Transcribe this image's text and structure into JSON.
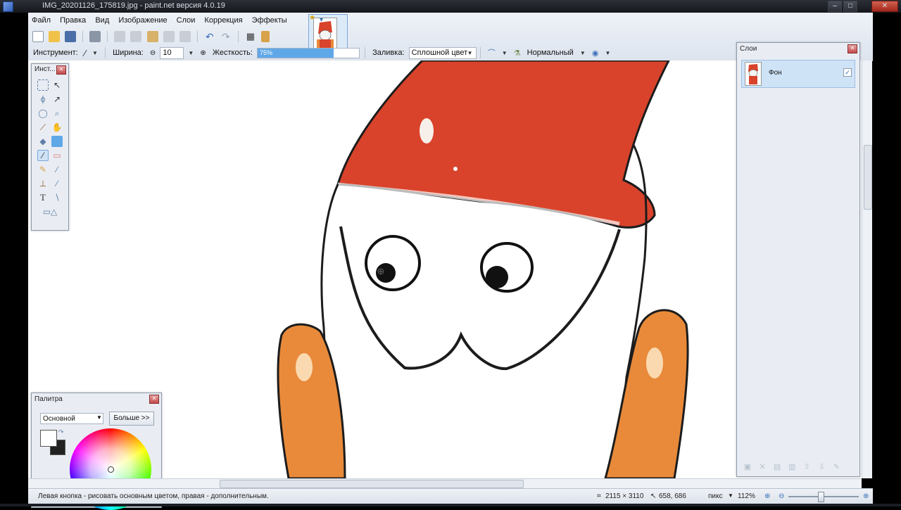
{
  "window": {
    "title": "IMG_20201126_175819.jpg - paint.net версия 4.0.19"
  },
  "menu": [
    "Файл",
    "Правка",
    "Вид",
    "Изображение",
    "Слои",
    "Коррекция",
    "Эффекты"
  ],
  "toolbar_options": {
    "tool_label": "Инструмент:",
    "width_label": "Ширина:",
    "width_value": "10",
    "hardness_label": "Жесткость:",
    "hardness_value": "75%",
    "hardness_percent": 75,
    "fill_label": "Заливка:",
    "fill_value": "Сплошной цвет",
    "blend_value": "Нормальный"
  },
  "tools_panel": {
    "title": "Инст..."
  },
  "palette_panel": {
    "title": "Палитра",
    "mode": "Основной",
    "more_button": "Больше >>",
    "colors": {
      "primary": "#ffffff",
      "secondary": "#222222"
    }
  },
  "layers_panel": {
    "title": "Слои",
    "layers": [
      {
        "name": "Фон",
        "visible": true
      }
    ]
  },
  "status": {
    "hint": "Левая кнопка - рисовать основным цветом, правая - дополнительным.",
    "image_size": "2115 × 3110",
    "cursor_pos": "658, 686",
    "units": "пикс",
    "zoom": "112%"
  },
  "colors": {
    "hat_red": "#d9432b",
    "skin_orange": "#e88a3a",
    "outline": "#1c1c1c",
    "accent": "#5fa8e8"
  }
}
